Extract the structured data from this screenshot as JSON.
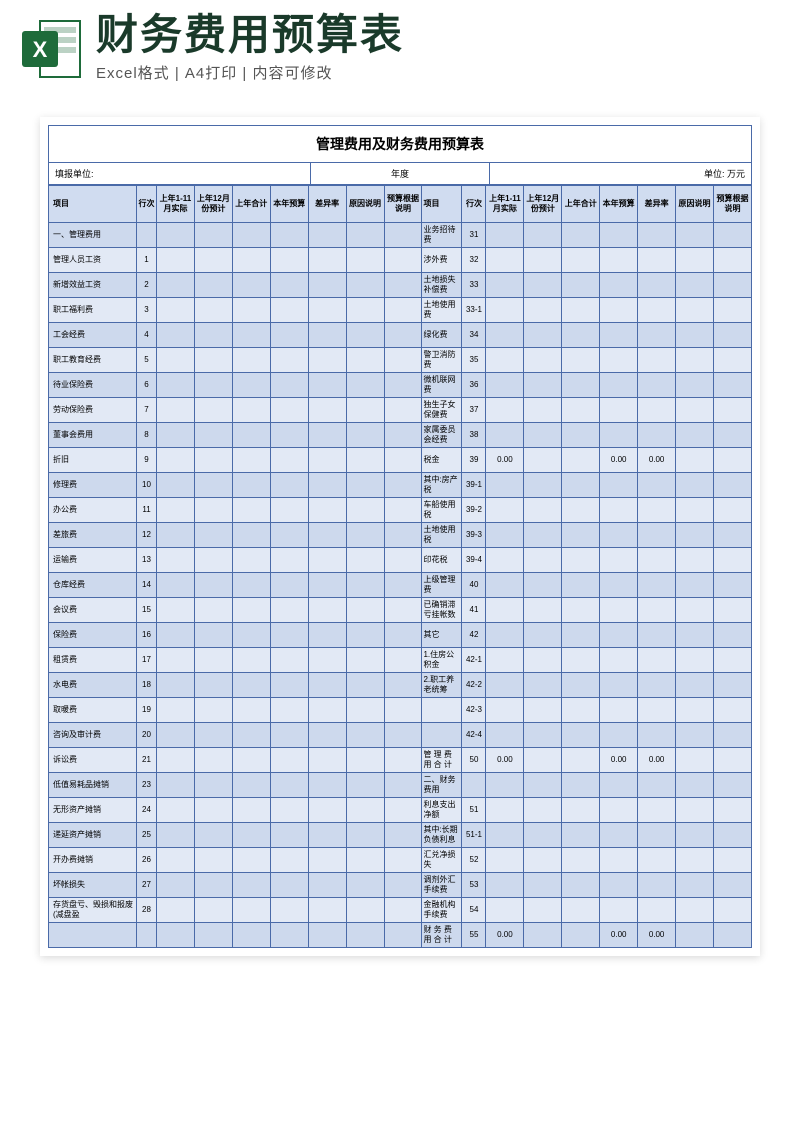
{
  "header": {
    "title": "财务费用预算表",
    "subtitle": "Excel格式 | A4打印 | 内容可修改"
  },
  "sheet": {
    "title": "管理费用及财务费用预算表",
    "meta": {
      "org_label": "填报单位:",
      "year_label": "年度",
      "unit_label": "单位: 万元"
    },
    "cols": [
      "项目",
      "行次",
      "上年1-11月实际",
      "上年12月份预计",
      "上年合计",
      "本年预算",
      "差异率",
      "原因说明",
      "预算根据说明",
      "项目",
      "行次",
      "上年1-11月实际",
      "上年12月份预计",
      "上年合计",
      "本年预算",
      "差异率",
      "原因说明",
      "预算根据说明"
    ],
    "rows": [
      {
        "l": "一、管理费用",
        "ln": "",
        "r": "业务招待费",
        "rn": "31"
      },
      {
        "l": "管理人员工资",
        "ln": "1",
        "r": "涉外费",
        "rn": "32"
      },
      {
        "l": "新增效益工资",
        "ln": "2",
        "r": "土地损失补偿费",
        "rn": "33"
      },
      {
        "l": "职工福利费",
        "ln": "3",
        "r": "土地使用费",
        "rn": "33-1"
      },
      {
        "l": "工会经费",
        "ln": "4",
        "r": "绿化费",
        "rn": "34"
      },
      {
        "l": "职工教育经费",
        "ln": "5",
        "r": "警卫消防费",
        "rn": "35"
      },
      {
        "l": "待业保险费",
        "ln": "6",
        "r": "微机联网费",
        "rn": "36"
      },
      {
        "l": "劳动保险费",
        "ln": "7",
        "r": "独生子女保健费",
        "rn": "37"
      },
      {
        "l": "董事会费用",
        "ln": "8",
        "r": "家属委员会经费",
        "rn": "38"
      },
      {
        "l": "折旧",
        "ln": "9",
        "r": "税金",
        "rn": "39",
        "rv1": "0.00",
        "rv4": "0.00",
        "rv5": "0.00"
      },
      {
        "l": "修理费",
        "ln": "10",
        "r": "其中:房产税",
        "rn": "39-1"
      },
      {
        "l": "办公费",
        "ln": "11",
        "r": "车船使用税",
        "rn": "39-2"
      },
      {
        "l": "差旅费",
        "ln": "12",
        "r": "土地使用税",
        "rn": "39-3"
      },
      {
        "l": "运输费",
        "ln": "13",
        "r": "印花税",
        "rn": "39-4"
      },
      {
        "l": "仓库经费",
        "ln": "14",
        "r": "上级管理费",
        "rn": "40"
      },
      {
        "l": "会议费",
        "ln": "15",
        "r": "已确销滞亏挂帐数",
        "rn": "41"
      },
      {
        "l": "保险费",
        "ln": "16",
        "r": "其它",
        "rn": "42"
      },
      {
        "l": "租赁费",
        "ln": "17",
        "r": "1.住房公积金",
        "rn": "42-1"
      },
      {
        "l": "水电费",
        "ln": "18",
        "r": "2.职工养老统筹",
        "rn": "42-2"
      },
      {
        "l": "取暖费",
        "ln": "19",
        "r": "",
        "rn": "42-3"
      },
      {
        "l": "咨询及审计费",
        "ln": "20",
        "r": "",
        "rn": "42-4"
      },
      {
        "l": "诉讼费",
        "ln": "21",
        "r": "管 理 费 用 合 计",
        "rn": "50",
        "rv1": "0.00",
        "rv4": "0.00",
        "rv5": "0.00"
      },
      {
        "l": "低值易耗品摊销",
        "ln": "23",
        "r": "二、财务费用",
        "rn": ""
      },
      {
        "l": "无形资产摊销",
        "ln": "24",
        "r": "利息支出净额",
        "rn": "51"
      },
      {
        "l": "递延资产摊销",
        "ln": "25",
        "r": "其中:长期负债利息",
        "rn": "51-1"
      },
      {
        "l": "开办费摊销",
        "ln": "26",
        "r": "汇兑净损失",
        "rn": "52"
      },
      {
        "l": "坏帐损失",
        "ln": "27",
        "r": "调剂外汇手续费",
        "rn": "53"
      },
      {
        "l": "存货盘亏、毁损和报废(减盘盈",
        "ln": "28",
        "r": "金融机构手续费",
        "rn": "54"
      },
      {
        "l": "",
        "ln": "",
        "r": "财 务 费 用 合 计",
        "rn": "55",
        "rv1": "0.00",
        "rv4": "0.00",
        "rv5": "0.00"
      }
    ]
  }
}
